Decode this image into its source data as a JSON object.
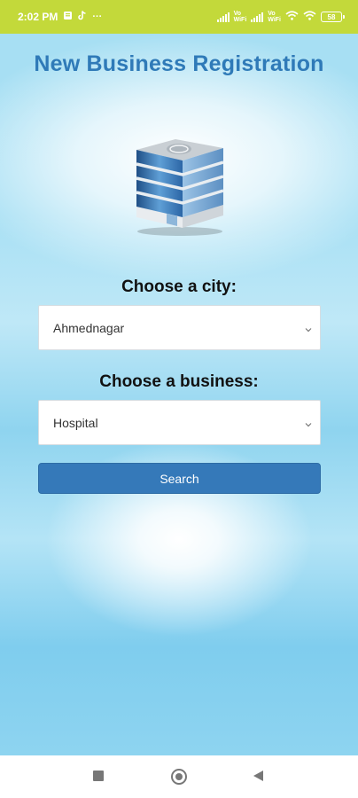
{
  "status_bar": {
    "time": "2:02 PM",
    "icons": [
      "notification-icon",
      "tiktok-icon",
      "more-dots-icon",
      "signal-icon",
      "volte-icon",
      "signal-icon",
      "volte-icon",
      "wifi-icon",
      "wifi-icon",
      "battery-icon"
    ],
    "volte_label": "Vo\nWiFi",
    "battery_level": "58",
    "more": "···"
  },
  "header": {
    "title": "New Business Registration"
  },
  "form": {
    "city_label": "Choose a city:",
    "city_value": "Ahmednagar",
    "business_label": "Choose a business:",
    "business_value": "Hospital",
    "search_label": "Search"
  },
  "colors": {
    "status_bar": "#c3d93a",
    "title": "#2f7ab8",
    "button": "#3579b9"
  }
}
